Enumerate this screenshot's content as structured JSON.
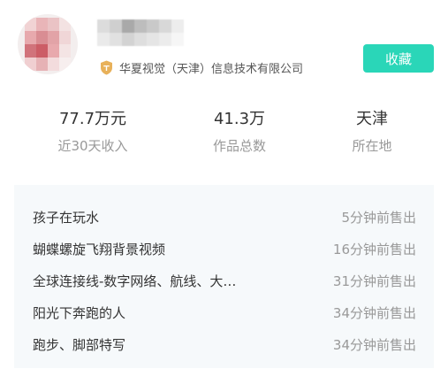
{
  "profile": {
    "company": "华夏视觉（天津）信息技术有限公司",
    "company_icon": "shield-badge-icon",
    "favorite_label": "收藏",
    "accent_color": "#2ad6b8"
  },
  "stats": [
    {
      "value": "77.7万元",
      "label": "近30天收入"
    },
    {
      "value": "41.3万",
      "label": "作品总数"
    },
    {
      "value": "天津",
      "label": "所在地"
    }
  ],
  "sales": [
    {
      "title": "孩子在玩水",
      "time": "5分钟前售出"
    },
    {
      "title": "蝴蝶螺旋飞翔背景视频",
      "time": "16分钟前售出"
    },
    {
      "title": "全球连接线-数字网络、航线、大…",
      "time": "31分钟前售出"
    },
    {
      "title": "阳光下奔跑的人",
      "time": "34分钟前售出"
    },
    {
      "title": "跑步、脚部特写",
      "time": "34分钟前售出"
    }
  ]
}
